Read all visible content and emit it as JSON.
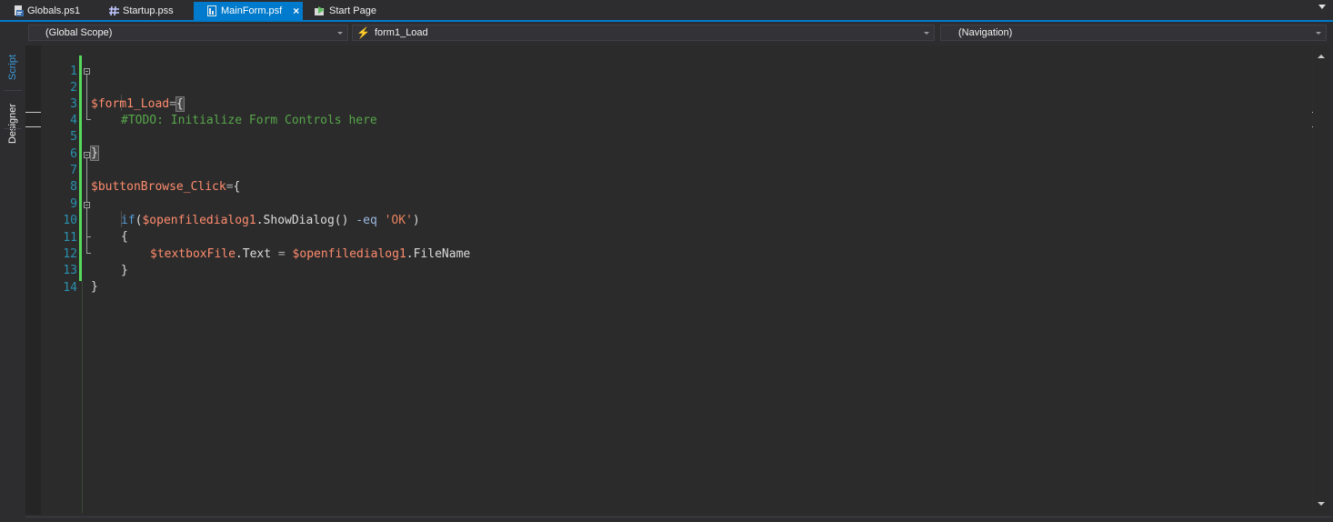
{
  "tabs": [
    {
      "label": "Globals.ps1",
      "icon": "script-file-icon",
      "active": false
    },
    {
      "label": "Startup.pss",
      "icon": "grid-icon",
      "active": false
    },
    {
      "label": "MainForm.psf",
      "icon": "form-file-icon",
      "active": true,
      "close": "×"
    },
    {
      "label": "Start Page",
      "icon": "start-page-icon",
      "active": false
    }
  ],
  "side_tabs": {
    "script": "Script",
    "designer": "Designer"
  },
  "navbar": {
    "scope": "(Global Scope)",
    "member": "form1_Load",
    "navigation": "(Navigation)"
  },
  "editor": {
    "line_numbers": [
      "1",
      "2",
      "3",
      "4",
      "5",
      "6",
      "7",
      "8",
      "9",
      "10",
      "11",
      "12",
      "13",
      "14"
    ],
    "tokens": {
      "l2_var": "$form1_Load",
      "l2_op": "=",
      "l2_brace": "{",
      "l3_comment": "#TODO: Initialize Form Controls here",
      "l5_brace": "}",
      "l7_var": "$buttonBrowse_Click",
      "l7_op": "=",
      "l7_brace": "{",
      "l9_kw": "if",
      "l9_paren": "(",
      "l9_var": "$openfiledialog1",
      "l9_method": ".ShowDialog() ",
      "l9_opkw": "-eq",
      "l9_sp": " ",
      "l9_str": "'OK'",
      "l9_close": ")",
      "l10_brace": "{",
      "l11_var1": "$textboxFile",
      "l11_prop": ".Text ",
      "l11_eq": "=",
      "l11_sp": " ",
      "l11_var2": "$openfiledialog1",
      "l11_prop2": ".FileName",
      "l12_brace": "}",
      "l13_brace": "}"
    }
  },
  "colors": {
    "accent": "#007acc",
    "change_bar": "#57d95b",
    "variable": "#ff8c6e",
    "comment": "#57a64a",
    "keyword": "#569cd6",
    "line_number": "#2b91af"
  }
}
